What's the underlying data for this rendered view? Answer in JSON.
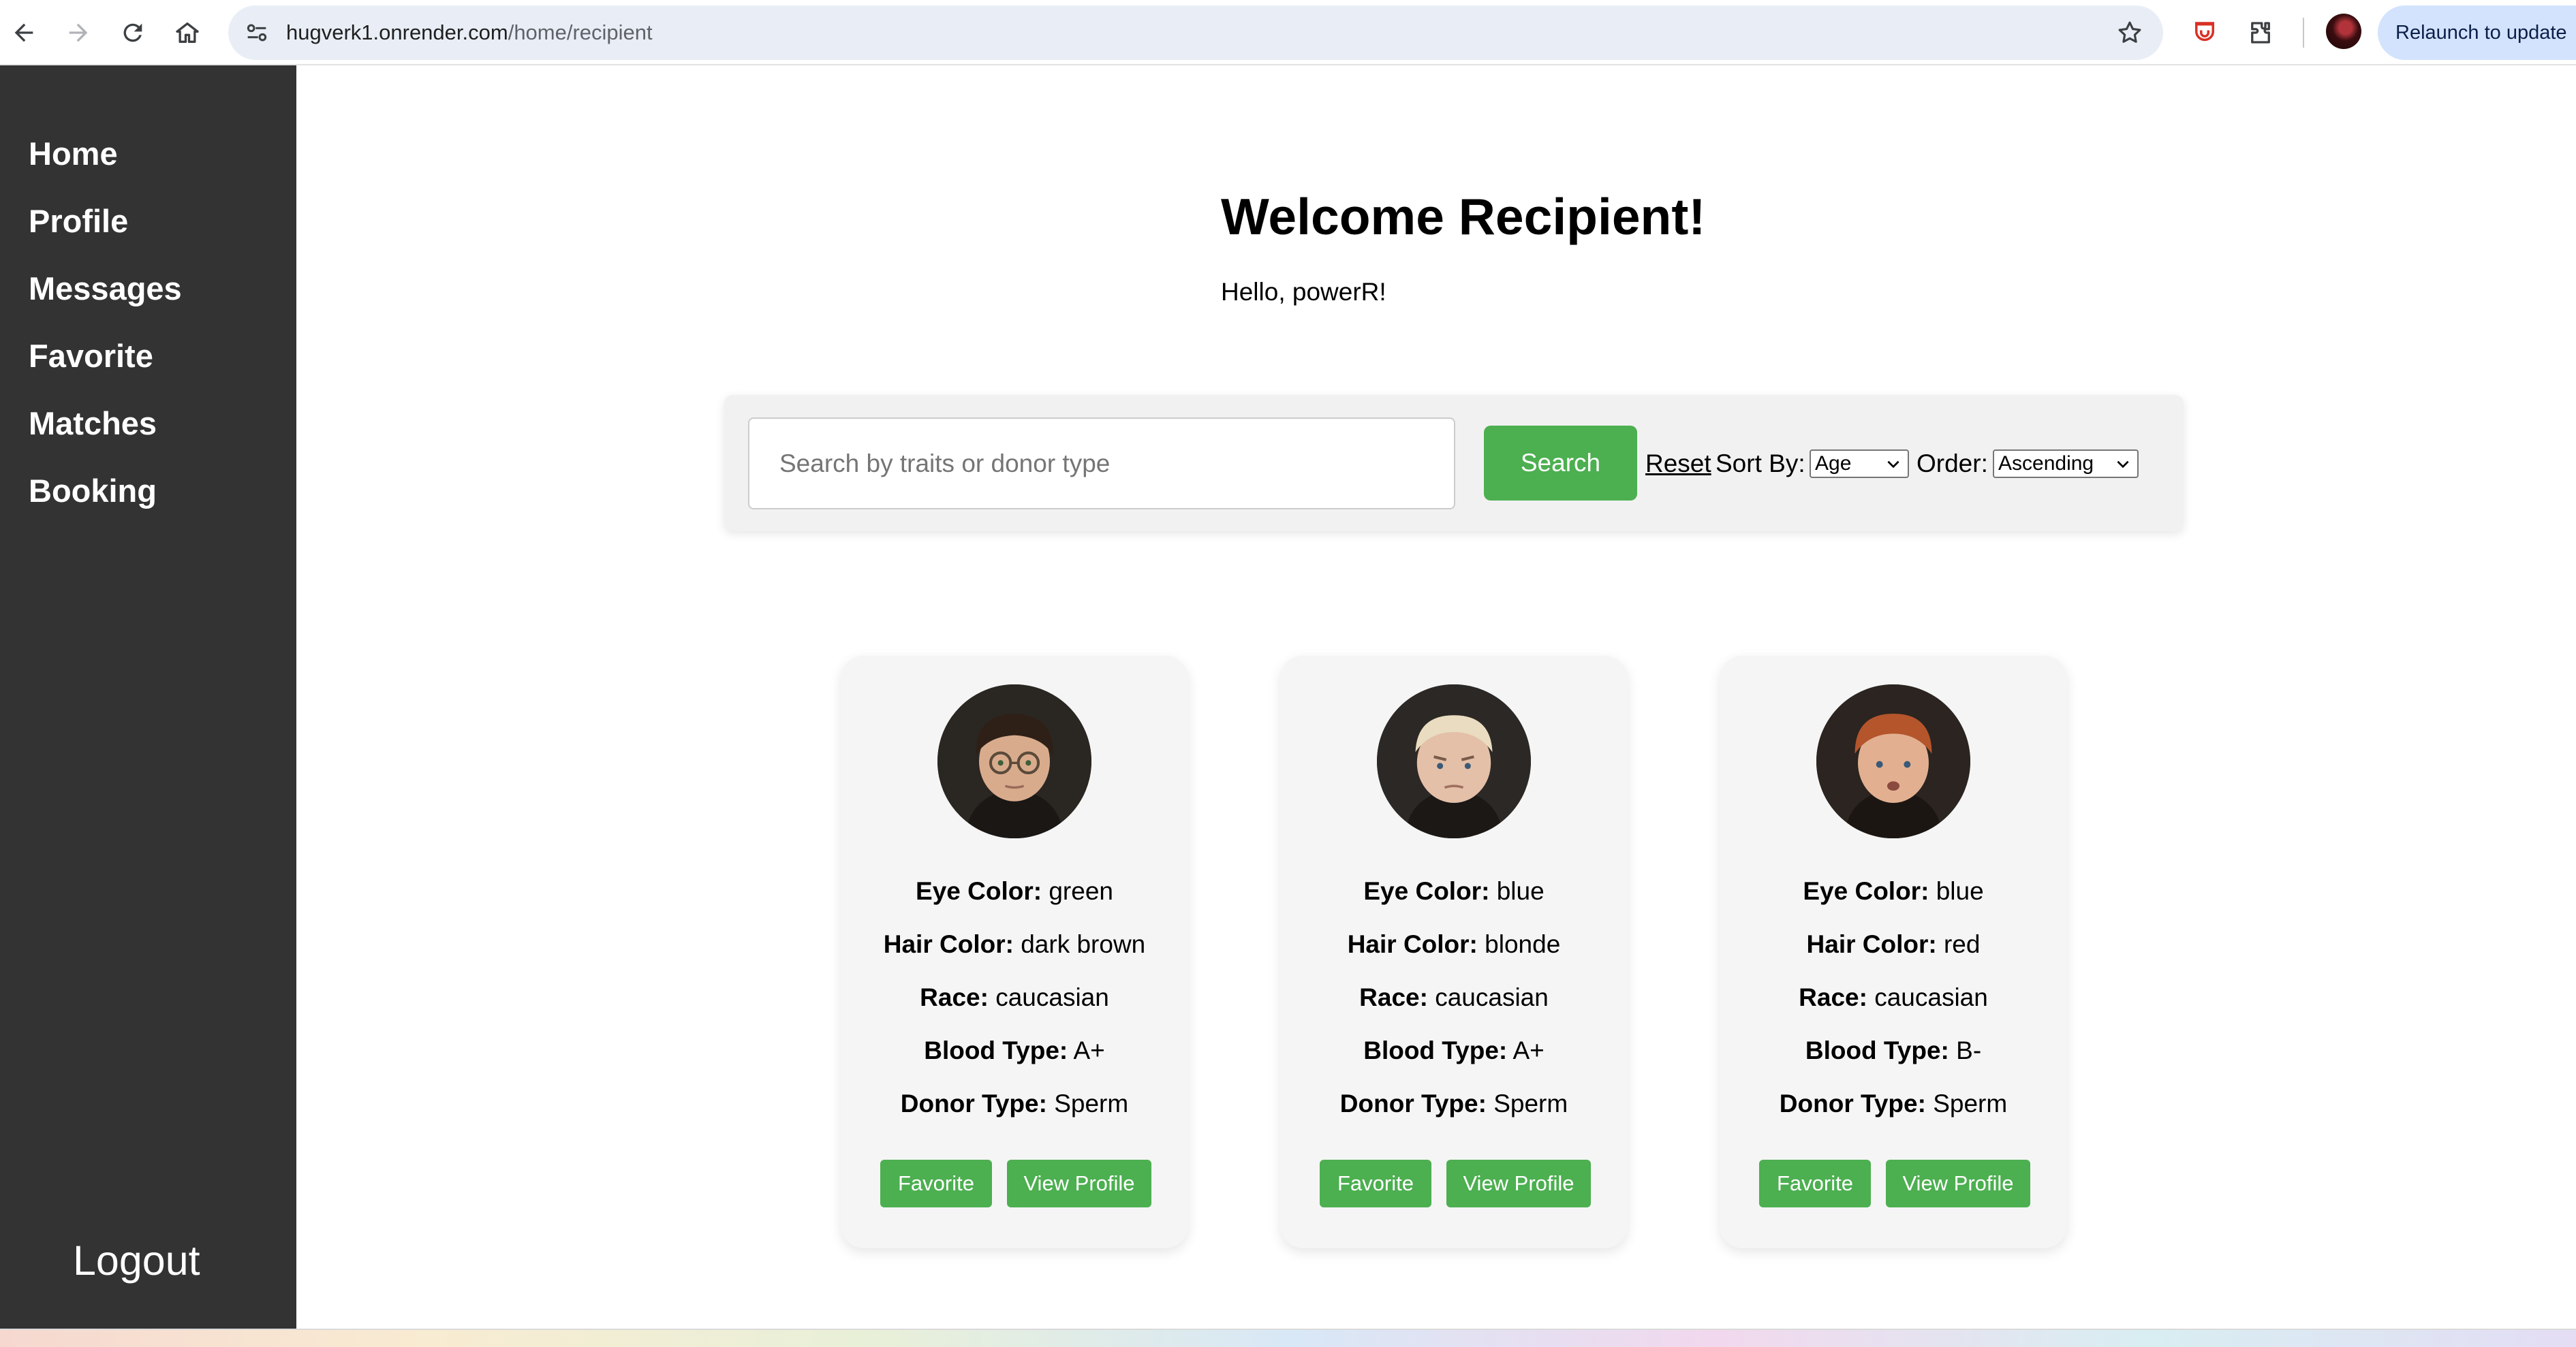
{
  "browser": {
    "url_host": "hugverk1.onrender.com",
    "url_path": "/home/recipient",
    "relaunch_label": "Relaunch to update"
  },
  "sidebar": {
    "items": [
      {
        "label": "Home"
      },
      {
        "label": "Profile"
      },
      {
        "label": "Messages"
      },
      {
        "label": "Favorite"
      },
      {
        "label": "Matches"
      },
      {
        "label": "Booking"
      }
    ],
    "logout_label": "Logout"
  },
  "main": {
    "title": "Welcome Recipient!",
    "greeting": "Hello, powerR!"
  },
  "search": {
    "placeholder": "Search by traits or donor type",
    "value": "",
    "button_label": "Search",
    "reset_label": "Reset",
    "sort_label": "Sort By:",
    "sort_value": "Age",
    "order_label": "Order:",
    "order_value": "Ascending"
  },
  "field_labels": {
    "eye": "Eye Color:",
    "hair": "Hair Color:",
    "race": "Race:",
    "blood": "Blood Type:",
    "donor": "Donor Type:"
  },
  "donors": [
    {
      "eye": "green",
      "hair": "dark brown",
      "race": "caucasian",
      "blood": "A+",
      "donor": "Sperm",
      "favorite_label": "Favorite",
      "view_label": "View Profile"
    },
    {
      "eye": "blue",
      "hair": "blonde",
      "race": "caucasian",
      "blood": "A+",
      "donor": "Sperm",
      "favorite_label": "Favorite",
      "view_label": "View Profile"
    },
    {
      "eye": "blue",
      "hair": "red",
      "race": "caucasian",
      "blood": "B-",
      "donor": "Sperm",
      "favorite_label": "Favorite",
      "view_label": "View Profile"
    }
  ],
  "colors": {
    "sidebar_bg": "#333333",
    "accent_green": "#4caf50",
    "card_bg": "#f5f5f5"
  }
}
